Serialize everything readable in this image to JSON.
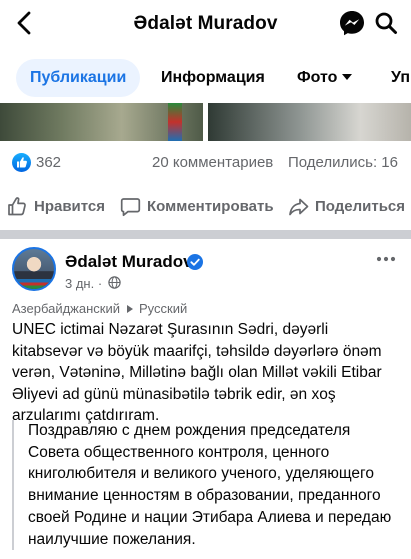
{
  "header": {
    "title": "Ədalət Muradov",
    "back_icon": "back-arrow-icon",
    "messenger_icon": "messenger-icon",
    "search_icon": "search-icon"
  },
  "tabs": [
    {
      "label": "Публикации",
      "active": true
    },
    {
      "label": "Информация",
      "active": false
    },
    {
      "label": "Фото",
      "active": false
    },
    {
      "label": "Уп",
      "active": false
    }
  ],
  "stats": {
    "likes": "362",
    "comments": "20 комментариев",
    "shares": "Поделились: 16"
  },
  "actions": {
    "like": "Нравится",
    "comment": "Комментировать",
    "share": "Поделиться"
  },
  "post": {
    "author": "Ədalət Muradov",
    "time": "3 дн. ·",
    "source_language": "Азербайджанский",
    "target_language": "Русский",
    "text": "UNEC ictimai Nəzarət Şurasının Sədri, dəyərli kitabsevər və böyük maarifçi, təhsildə dəyərlərə önəm verən, Vətəninə, Millətinə bağlı olan Millət vəkili Etibar Əliyevi ad günü münasibətilə təbrik edir, ən xoş arzularımı çatdırıram.",
    "translation": "Поздравляю с днем рождения председателя Совета общественного контроля, ценного книголюбителя и великого ученого, уделяющего внимание ценностям в образовании, преданного своей Родине и нации Этибара Алиева и передаю наилучшие пожелания."
  },
  "colors": {
    "accent": "#1b74e4",
    "tab_active_bg": "#ebf3ff",
    "secondary_text": "#65676b",
    "divider": "#ccced3"
  }
}
